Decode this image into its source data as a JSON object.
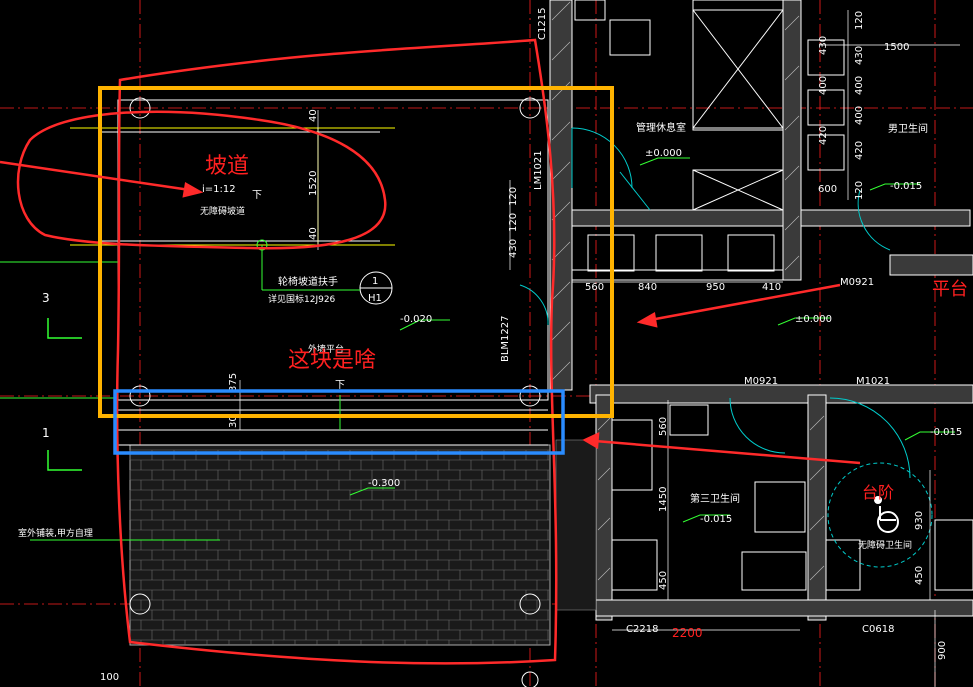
{
  "colors": {
    "background": "#000000",
    "wall_gray": "#8c8c8c",
    "cad_green": "#33ff33",
    "cad_red": "#ff2020",
    "cad_yellow": "#ffff00",
    "cad_cyan": "#00cccc",
    "annotation_red": "#ff2a2a",
    "annotation_orange": "#ffb300",
    "annotation_blue": "#2a8cff"
  },
  "annotations": {
    "ramp_label": "坡道",
    "what_is_this_label": "这块是啥",
    "platform_label": "平台",
    "steps_label": "台阶"
  },
  "drawing_text": {
    "ramp_slope": "i=1:12",
    "barrier_free_ramp": "无障碍坡道",
    "down_1": "下",
    "down_2": "下",
    "handrail_note": "轮椅坡道扶手",
    "handrail_ref": "详见国标12J926",
    "detail_num": "1",
    "detail_sheet": "H1",
    "elev_minus_020": "-0.020",
    "elev_minus_300": "-0.300",
    "elev_zero_1": "±0.000",
    "elev_zero_2": "±0.000",
    "elev_minus_015_a": "-0.015",
    "elev_minus_015_b": "-0.015",
    "elev_minus_015_c": "-0.015",
    "outdoor_paving": "室外铺装,甲方自理",
    "mgmt_room": "管理休息室",
    "male_wc": "男卫生间",
    "third_wc": "第三卫生间",
    "accessible_wc": "无障碍卫生间",
    "outdoor_platform": "外墙平台",
    "door_m0921_a": "M0921",
    "door_m0921_b": "M0921",
    "door_m1021": "M1021",
    "door_lm1021": "LM1021",
    "door_blm1227": "BLM1227",
    "window_c1215": "C1215",
    "window_c2218": "C2218",
    "window_c0618": "C0618",
    "axis_3": "3",
    "axis_1": "1",
    "dim_1500": "1500",
    "dim_600": "600",
    "dim_560": "560",
    "dim_840": "840",
    "dim_950": "950",
    "dim_410": "410",
    "dim_1520": "1520",
    "dim_40a": "40",
    "dim_40b": "40",
    "dim_120a": "120",
    "dim_120b": "120",
    "dim_430": "430",
    "dim_375": "375",
    "dim_30": "30",
    "dim_1450": "1450",
    "dim_450a": "450",
    "dim_450b": "450",
    "dim_560v": "560",
    "dim_930": "930",
    "dim_900": "900",
    "dim_100": "100",
    "dim_2200": "2200",
    "dim_430r": "430",
    "dim_400a": "400",
    "dim_400b": "400",
    "dim_420": "420",
    "dim_120r": "120",
    "dim_430r2": "430",
    "dim_400c": "400",
    "dim_420b": "420",
    "dim_120c": "120"
  }
}
